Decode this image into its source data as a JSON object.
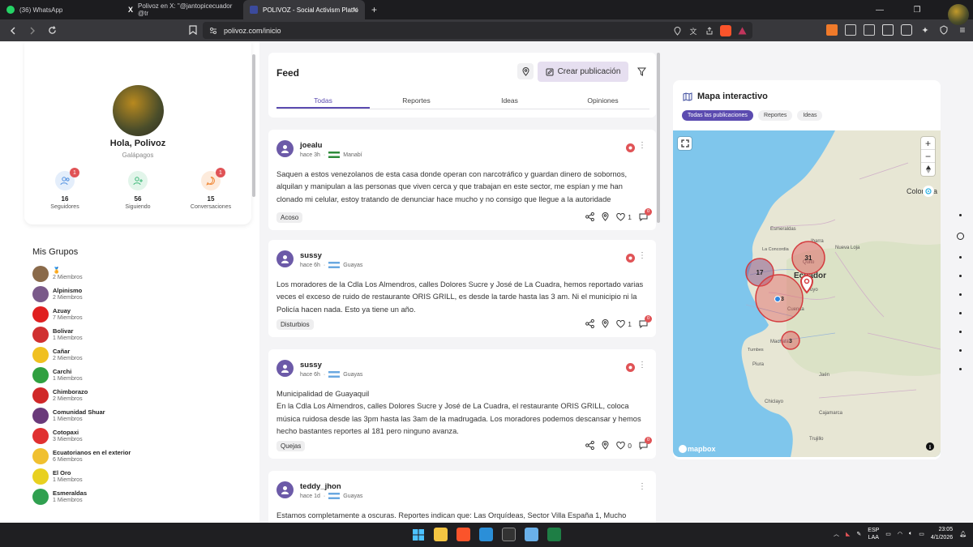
{
  "browser": {
    "tabs": [
      {
        "label": "(36) WhatsApp",
        "color": "#25d366"
      },
      {
        "label": "Polivoz en X: \"@jantopicecuador @tr",
        "color": "#000000"
      },
      {
        "label": "POLIVOZ - Social Activism Platfo",
        "color": "#3b4a9c"
      }
    ],
    "new_tab": "+",
    "url": "polivoz.com/inicio",
    "window_controls": [
      "—",
      "❐",
      "✕"
    ]
  },
  "profile": {
    "greeting": "Hola, Polivoz",
    "region": "Galápagos",
    "stats": [
      {
        "num": "16",
        "label": "Seguidores",
        "badge": "1",
        "color": "#4f8fe0"
      },
      {
        "num": "56",
        "label": "Siguiendo",
        "badge": "",
        "color": "#3cb878"
      },
      {
        "num": "15",
        "label": "Conversaciones",
        "badge": "1",
        "color": "#f08a3a"
      }
    ]
  },
  "groups": {
    "title": "Mis Grupos",
    "items": [
      {
        "name": "🏅",
        "count": "2 Miembros",
        "color": "#8a6a4a"
      },
      {
        "name": "Alpinismo",
        "count": "2 Miembros",
        "color": "#7a5a8a"
      },
      {
        "name": "Azuay",
        "count": "7 Miembros",
        "color": "#e02020"
      },
      {
        "name": "Bolivar",
        "count": "1 Miembros",
        "color": "#d03030"
      },
      {
        "name": "Cañar",
        "count": "2 Miembros",
        "color": "#f0c020"
      },
      {
        "name": "Carchi",
        "count": "1 Miembros",
        "color": "#30a040"
      },
      {
        "name": "Chimborazo",
        "count": "2 Miembros",
        "color": "#d02828"
      },
      {
        "name": "Comunidad Shuar",
        "count": "1 Miembros",
        "color": "#6a3a7a"
      },
      {
        "name": "Cotopaxi",
        "count": "3 Miembros",
        "color": "#e03030"
      },
      {
        "name": "Ecuatorianos en el exterior",
        "count": "6 Miembros",
        "color": "#f0c030"
      },
      {
        "name": "El Oro",
        "count": "1 Miembros",
        "color": "#e8d020"
      },
      {
        "name": "Esmeraldas",
        "count": "1 Miembros",
        "color": "#30a050"
      }
    ]
  },
  "feed": {
    "title": "Feed",
    "create_label": "Crear publicación",
    "tabs": [
      "Todas",
      "Reportes",
      "Ideas",
      "Opiniones"
    ],
    "posts": [
      {
        "user": "joealu",
        "time": "hace 3h",
        "place": "Manabí",
        "flag_color": "#2e8b3a",
        "body": "Saquen a estos venezolanos de esta casa donde operan con narcotráfico y guardan dinero de sobornos, alquilan y manipulan a las personas que viven cerca y que trabajan en este sector, me espían y me han clonado mi celular, estoy tratando de denunciar hace mucho y no consigo que llegue a la autoridade",
        "tag": "Acoso",
        "likes": "1",
        "comments_badge": "0"
      },
      {
        "user": "sussy",
        "time": "hace 6h",
        "place": "Guayas",
        "flag_color": "#6aa8e0",
        "body": "Los moradores de la Cdla Los Almendros, calles Dolores Sucre y José de La Cuadra, hemos reportado varias veces el exceso de ruido de restaurante ORIS GRILL, es desde la tarde hasta las 3 am. Ni el municipio ni la Policía hacen nada. Esto ya tiene un año.",
        "tag": "Disturbios",
        "likes": "1",
        "comments_badge": "0"
      },
      {
        "user": "sussy",
        "time": "hace 6h",
        "place": "Guayas",
        "flag_color": "#6aa8e0",
        "body": "Municipalidad de Guayaquil\nEn la Cdla Los Almendros, calles Dolores Sucre y José de La Cuadra, el restaurante ORIS GRILL, coloca música ruidosa desde las 3pm hasta las 3am de la madrugada. Los moradores podemos descansar y hemos hecho bastantes reportes al 181 pero ninguno avanza.",
        "tag": "Quejas",
        "likes": "0",
        "comments_badge": "0"
      },
      {
        "user": "teddy_jhon",
        "time": "hace 1d",
        "place": "Guayas",
        "flag_color": "#6aa8e0",
        "body": "Estamos completamente a oscuras. Reportes indican que: Las Orquídeas, Sector Villa España 1, Mucho",
        "tag": "",
        "likes": "",
        "comments_badge": ""
      }
    ]
  },
  "map": {
    "title": "Mapa interactivo",
    "filters": [
      "Todas las publicaciones",
      "Reportes",
      "Ideas"
    ],
    "labels": [
      "Colombia",
      "Ecuador",
      "Esmeraldas",
      "Ibarra",
      "Nueva Loja",
      "La Concordia",
      "Quito",
      "Puyo",
      "Cuenca",
      "Machala",
      "Jaén",
      "Piura",
      "Chiclayo",
      "Cajamarca",
      "Trujillo",
      "Tumbes"
    ],
    "clusters": [
      "31",
      "17",
      "3",
      "3"
    ],
    "logo": "mapbox",
    "info": "i"
  },
  "taskbar": {
    "lang1": "ESP",
    "lang2": "LAA",
    "time": "23:05",
    "date": "4/1/2026"
  }
}
